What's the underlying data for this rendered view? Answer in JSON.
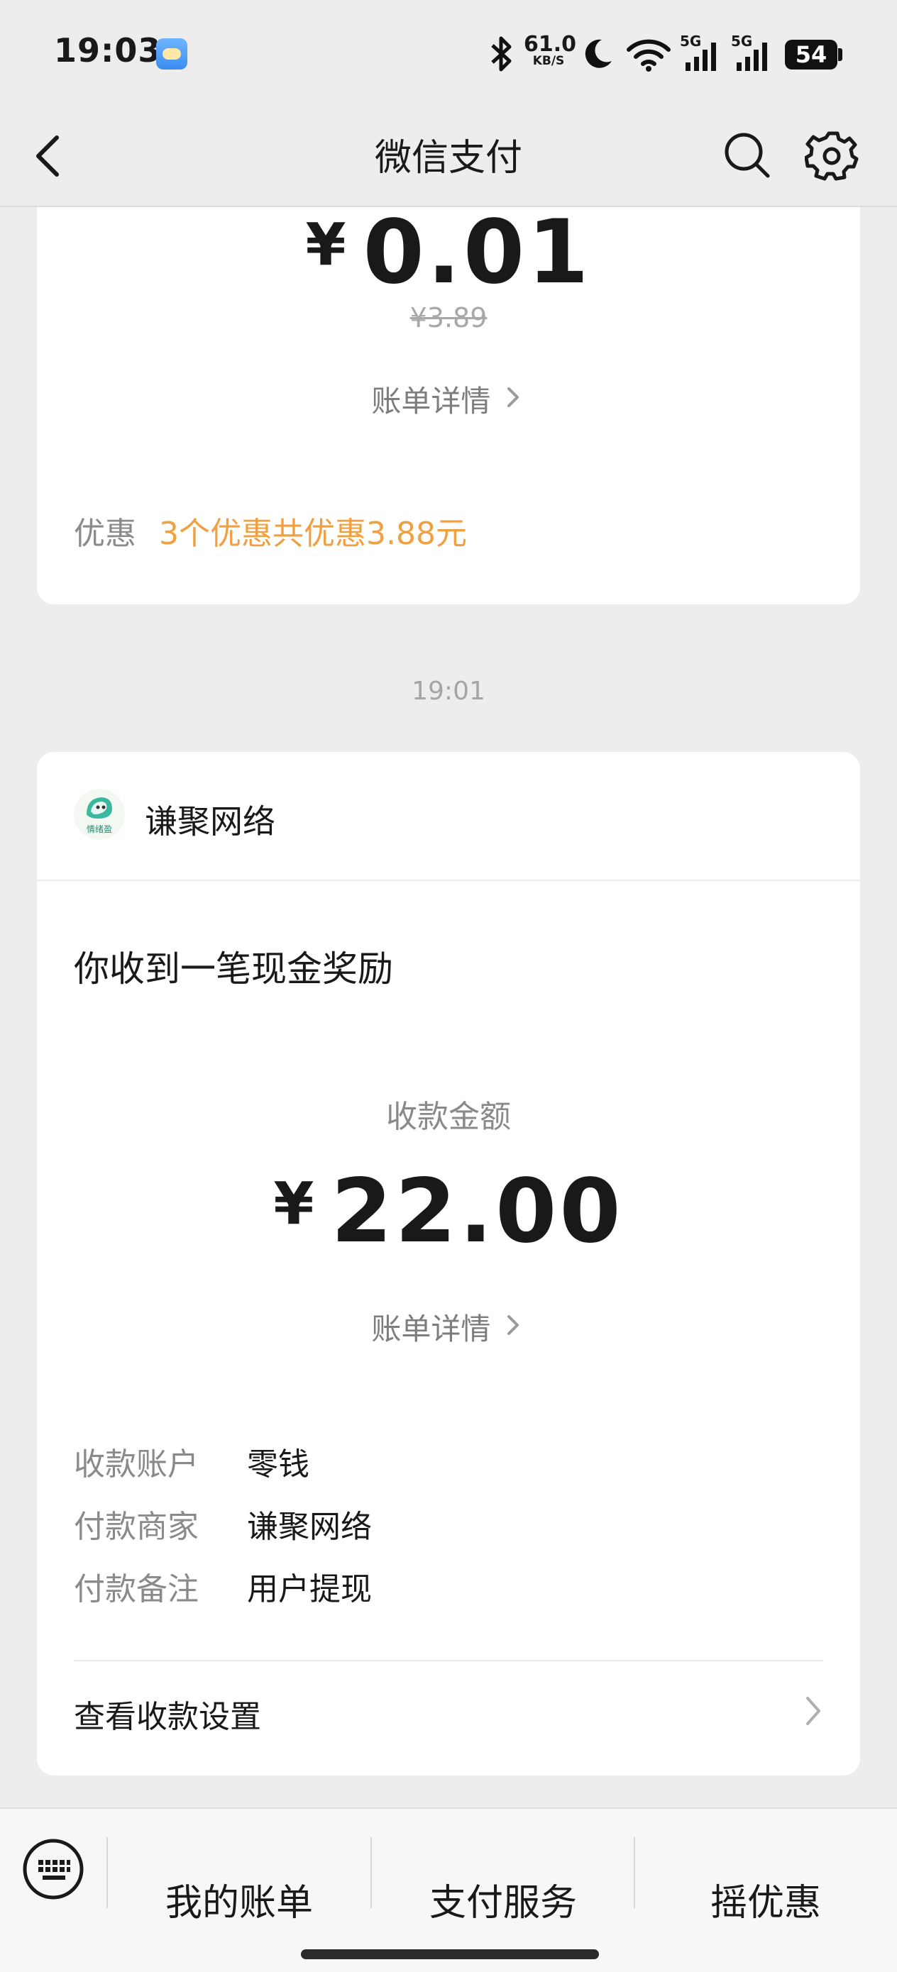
{
  "status_bar": {
    "time": "19:03",
    "network_speed": "61.0",
    "network_speed_unit": "KB/S",
    "signal_1": "5G",
    "signal_2": "5G",
    "battery": "54"
  },
  "header": {
    "title": "微信支付",
    "back_icon": "chevron-left-icon",
    "search_icon": "search-icon",
    "settings_icon": "gear-icon"
  },
  "card_1": {
    "currency": "¥",
    "amount": "0.01",
    "original_price": "¥3.89",
    "detail_link": "账单详情",
    "discount_label": "优惠",
    "discount_value": "3个优惠共优惠3.88元"
  },
  "timestamp": "19:01",
  "card_2": {
    "merchant_name": "谦聚网络",
    "merchant_logo_text": "情绪盈",
    "message": "你收到一笔现金奖励",
    "amount_label": "收款金额",
    "currency": "¥",
    "amount": "22.00",
    "detail_link": "账单详情",
    "rows": [
      {
        "label": "收款账户",
        "value": "零钱"
      },
      {
        "label": "付款商家",
        "value": "谦聚网络"
      },
      {
        "label": "付款备注",
        "value": "用户提现"
      }
    ],
    "settings_link": "查看收款设置"
  },
  "bottom_bar": {
    "keyboard_icon": "keyboard-icon",
    "tabs": [
      "我的账单",
      "支付服务",
      "摇优惠"
    ]
  },
  "colors": {
    "accent_orange": "#f0a040",
    "background": "#ededed"
  }
}
